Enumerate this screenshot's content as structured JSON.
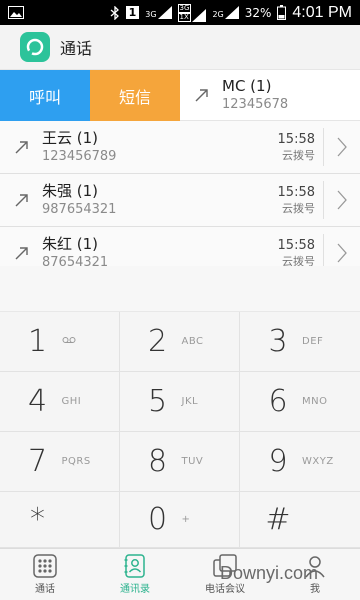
{
  "status_bar": {
    "network_3g_a": "3G",
    "network_3g_b": "3G",
    "network_1x": "1X",
    "network_2g": "2G",
    "sim_badge": "1",
    "battery": "32%",
    "time": "4:01 PM"
  },
  "app": {
    "title": "通话"
  },
  "actions": {
    "call_label": "呼叫",
    "sms_label": "短信"
  },
  "first_contact": {
    "name": "MC (1)",
    "number": "12345678"
  },
  "contacts": [
    {
      "name": "王云 (1)",
      "number": "123456789",
      "time": "15:58",
      "via": "云拨号"
    },
    {
      "name": "朱强 (1)",
      "number": "987654321",
      "time": "15:58",
      "via": "云拨号"
    },
    {
      "name": "朱红 (1)",
      "number": "87654321",
      "time": "15:58",
      "via": "云拨号"
    }
  ],
  "keypad": [
    {
      "digit": "1",
      "letters": ""
    },
    {
      "digit": "2",
      "letters": "ABC"
    },
    {
      "digit": "3",
      "letters": "DEF"
    },
    {
      "digit": "4",
      "letters": "GHI"
    },
    {
      "digit": "5",
      "letters": "JKL"
    },
    {
      "digit": "6",
      "letters": "MNO"
    },
    {
      "digit": "7",
      "letters": "PQRS"
    },
    {
      "digit": "8",
      "letters": "TUV"
    },
    {
      "digit": "9",
      "letters": "WXYZ"
    },
    {
      "digit": "*",
      "letters": ""
    },
    {
      "digit": "0",
      "letters": "+"
    },
    {
      "digit": "#",
      "letters": ""
    }
  ],
  "nav": [
    {
      "label": "通话",
      "icon": "dialpad-icon",
      "active": false
    },
    {
      "label": "通讯录",
      "icon": "contacts-book-icon",
      "active": true
    },
    {
      "label": "电话会议",
      "icon": "conference-icon",
      "active": false
    },
    {
      "label": "我",
      "icon": "person-icon",
      "active": false
    }
  ],
  "watermark": "Downyi.com",
  "colors": {
    "call": "#2e9ff0",
    "sms": "#f5a53b",
    "accent": "#2cb38e"
  }
}
